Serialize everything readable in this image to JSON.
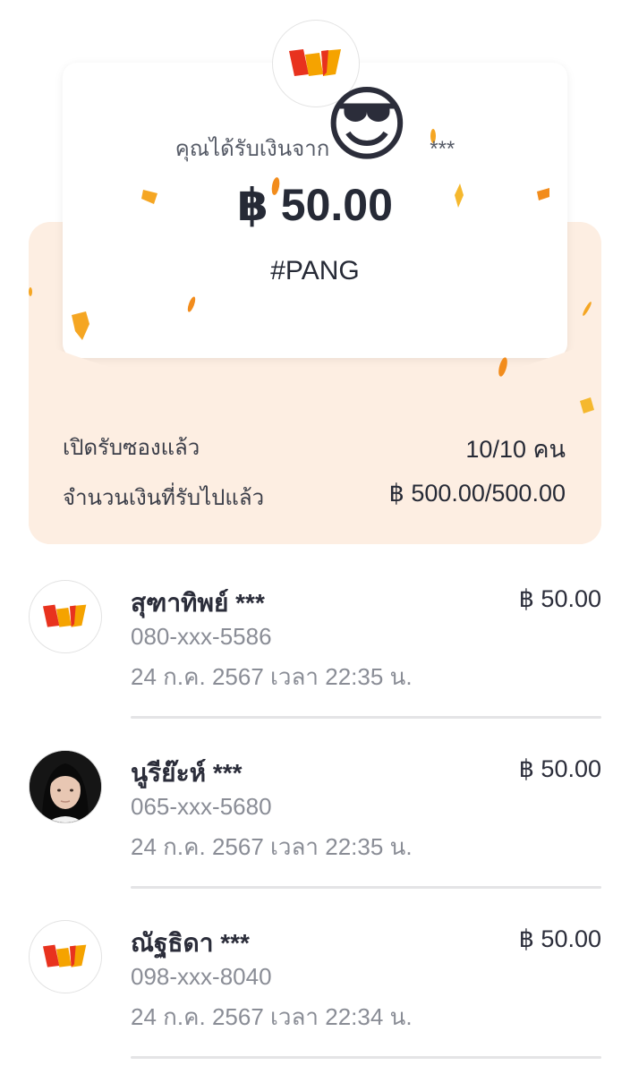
{
  "header": {
    "from_text": "คุณได้รับเงินจาก",
    "masked_suffix": "***",
    "amount": "฿ 50.00",
    "tag": "#PANG"
  },
  "summary": {
    "opened_label": "เปิดรับซองแล้ว",
    "opened_value": "10/10 คน",
    "received_label": "จำนวนเงินที่รับไปแล้ว",
    "received_value": "฿ 500.00/500.00"
  },
  "recipients": [
    {
      "name": "สุฑาทิพย์ ***",
      "phone": "080-xxx-5586",
      "time": "24 ก.ค. 2567 เวลา 22:35 น.",
      "amount": "฿ 50.00",
      "avatar": "truemoney-logo-icon"
    },
    {
      "name": "นูรีย๊ะห์ ***",
      "phone": "065-xxx-5680",
      "time": "24 ก.ค. 2567 เวลา 22:35 น.",
      "amount": "฿ 50.00",
      "avatar": "user-photo"
    },
    {
      "name": "ณัฐธิดา ***",
      "phone": "098-xxx-8040",
      "time": "24 ก.ค. 2567 เวลา 22:34 น.",
      "amount": "฿ 50.00",
      "avatar": "truemoney-logo-icon"
    }
  ],
  "colors": {
    "envelope": "#fdeee2",
    "confetti": "#f5a623",
    "logo_red": "#e8321e",
    "logo_orange": "#f5a300"
  }
}
